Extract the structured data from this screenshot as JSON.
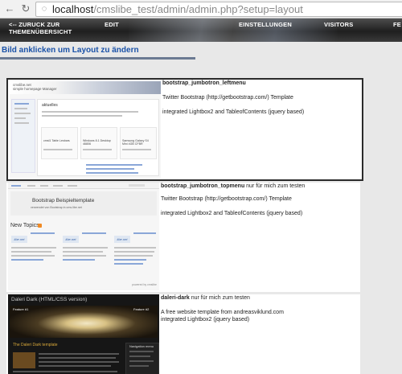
{
  "browser": {
    "url_host": "localhost",
    "url_path": "/cmslibe_test/admin/admin.php?setup=layout"
  },
  "nav": {
    "back_label_line1": "<-- ZURUCK ZUR",
    "back_label_line2": "THEMENÜBERSICHT",
    "edit": "EDIT",
    "settings": "EINSTELLUNGEN",
    "visitors": "VISITORS",
    "cut": "FE"
  },
  "page": {
    "heading": "Bild anklicken um Layout zu ändern"
  },
  "layouts": [
    {
      "name": "bootstrap_jumbotron_leftmenu",
      "note": "",
      "line1": "Twitter Bootstrap (http://getbootstrap.com/) Template",
      "line2": "integrated Lightbox2 and TableofContents (jquery based)",
      "selected": true,
      "thumb": {
        "title_line1": "cmslibe.net",
        "title_line2": "simple homepage Manager",
        "section": "aktuelles",
        "col1": "cmsl1 Table Lesbars",
        "col2": "Windows 8.1 Desktop 46806",
        "col3": "Samsung Galaxy S4 Mini 4GB CFBR"
      }
    },
    {
      "name": "bootstrap_jumbotron_topmenu",
      "note": " nur für mich zum testen",
      "line1": "Twitter Bootstrap (http://getbootstrap.com/) Template",
      "line2": "integrated Lightbox2 and TableofContents (jquery based)",
      "selected": false,
      "thumb": {
        "jumbo_title": "Bootstrap Beispieltemplate",
        "jumbo_sub": "verwendet von Bootstrap in cms.libe.net",
        "topics": "New Topics",
        "logo": "libe.net",
        "powered": "powered by cmslibe"
      }
    },
    {
      "name": "daleri-dark",
      "note": " nur für mich zum testen",
      "line1": "A free website template from andreasviklund.com",
      "line2": "integrated Lightbox2 (jquery based)",
      "selected": false,
      "thumb": {
        "site_title": "Daleri Dark (HTML/CSS version)",
        "feature_left": "Feature #1",
        "feature_right": "Feature #2",
        "post_title": "The Daleri Dark template",
        "nav_title": "Navigation menu"
      }
    }
  ],
  "colors": {
    "heading": "#1a52a8",
    "selected_border": "#2b2b2b",
    "nav_bg": "#2a2a2a",
    "page_bg": "#e8e8e8"
  }
}
